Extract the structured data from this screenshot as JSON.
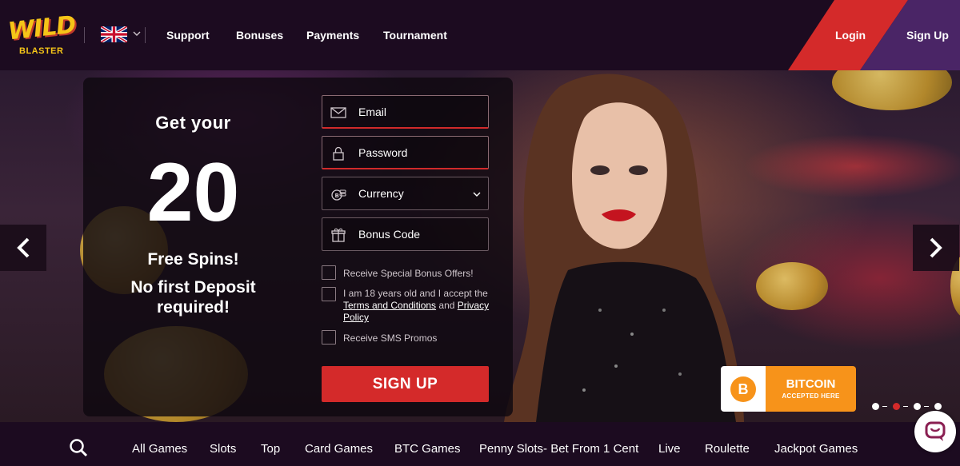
{
  "header": {
    "logo_top": "WILD",
    "logo_bottom": "BLASTER",
    "nav": [
      "Support",
      "Bonuses",
      "Payments",
      "Tournament"
    ],
    "login": "Login",
    "signup": "Sign Up"
  },
  "promo": {
    "line1": "Get your",
    "number": "20",
    "line2": "Free Spins!",
    "line3a": "No first Deposit",
    "line3b": "required!"
  },
  "form": {
    "email": "Email",
    "password": "Password",
    "currency": "Currency",
    "bonus_code": "Bonus Code",
    "check1": "Receive Special Bonus Offers!",
    "check2_pre": "I am 18 years old and I accept the",
    "check2_terms": "Terms and Conditions",
    "check2_and": " and ",
    "check2_privacy": "Privacy Policy",
    "check3": "Receive SMS Promos",
    "submit": "SIGN UP"
  },
  "badge": {
    "title": "BITCOIN",
    "subtitle": "ACCEPTED HERE",
    "symbol": "B"
  },
  "slider": {
    "count": 4,
    "active_index": 1
  },
  "categories": [
    "All Games",
    "Slots",
    "Top",
    "Card Games",
    "BTC Games",
    "Penny Slots- Bet From 1 Cent",
    "Live",
    "Roulette",
    "Jackpot Games"
  ],
  "colors": {
    "header_bg": "#1c0b20",
    "accent_red": "#d42a2a",
    "accent_purple": "#4a2566",
    "bitcoin_orange": "#f7931a",
    "logo_yellow": "#f5c518"
  },
  "icons": {
    "email": "envelope-icon",
    "password": "lock-icon",
    "currency": "coins-icon",
    "bonus": "gift-icon",
    "search": "search-icon",
    "chat": "chat-icon"
  }
}
